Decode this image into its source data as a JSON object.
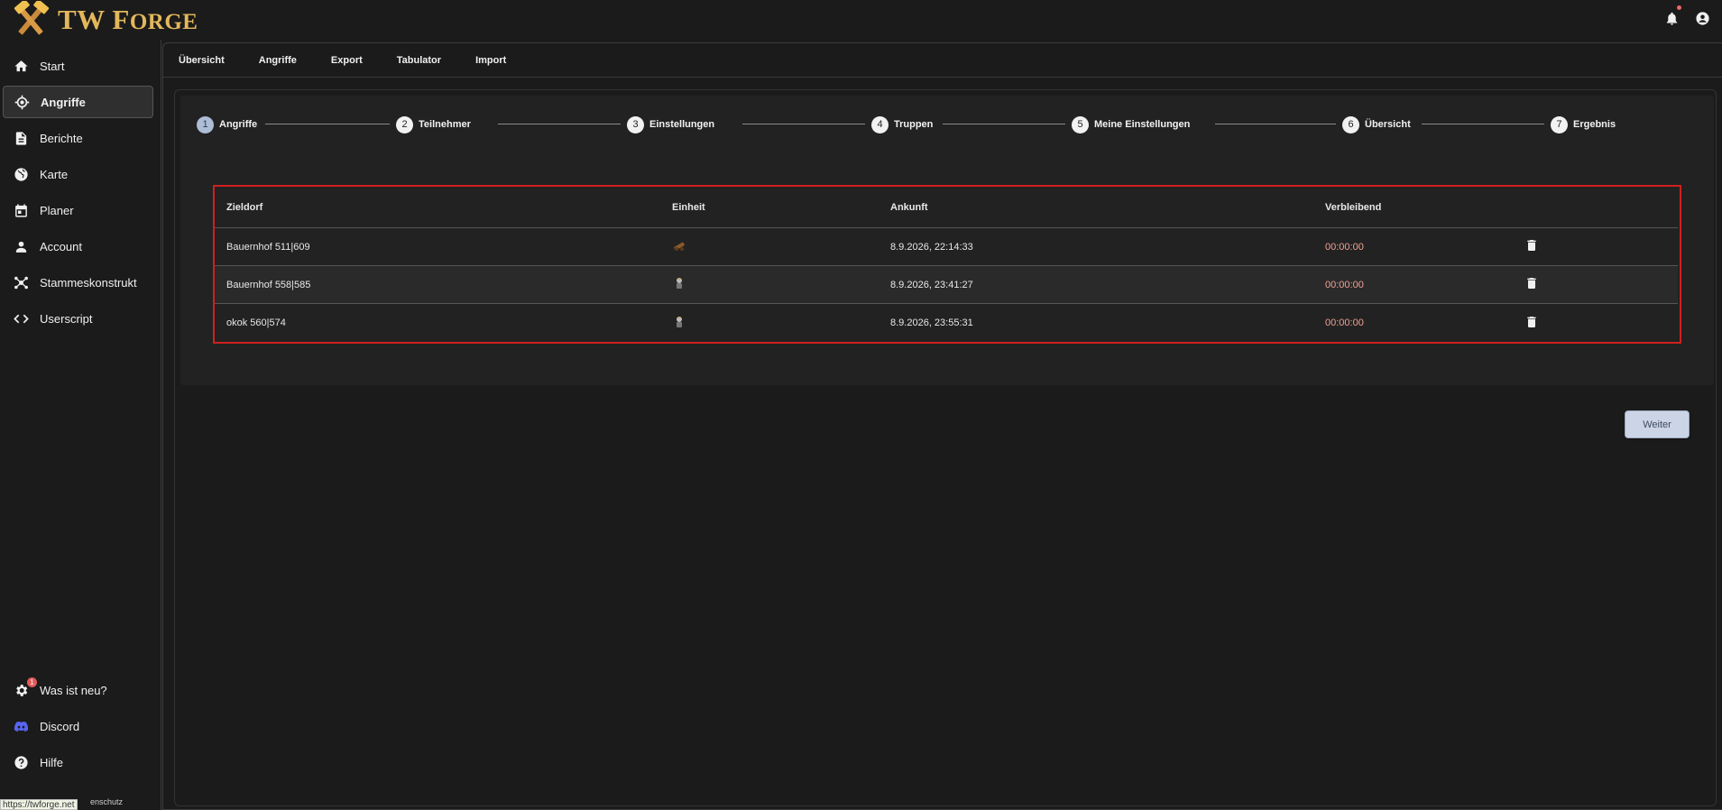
{
  "brand": {
    "name_big": "TW F",
    "name_small": "ORGE"
  },
  "sidebar": {
    "items": [
      {
        "label": "Start",
        "icon": "home-icon"
      },
      {
        "label": "Angriffe",
        "icon": "target-icon"
      },
      {
        "label": "Berichte",
        "icon": "document-icon"
      },
      {
        "label": "Karte",
        "icon": "globe-icon"
      },
      {
        "label": "Planer",
        "icon": "calendar-icon"
      },
      {
        "label": "Account",
        "icon": "user-icon"
      },
      {
        "label": "Stammeskonstrukt",
        "icon": "network-icon"
      },
      {
        "label": "Userscript",
        "icon": "code-icon"
      }
    ],
    "bottom_items": [
      {
        "label": "Was ist neu?",
        "icon": "gear-icon",
        "badge": "1"
      },
      {
        "label": "Discord",
        "icon": "discord-icon"
      },
      {
        "label": "Hilfe",
        "icon": "help-icon"
      }
    ],
    "footer_link": "enschutz",
    "status_url": "https://twforge.net"
  },
  "tabs": [
    "Übersicht",
    "Angriffe",
    "Export",
    "Tabulator",
    "Import"
  ],
  "stepper": [
    {
      "num": "1",
      "label": "Angriffe"
    },
    {
      "num": "2",
      "label": "Teilnehmer"
    },
    {
      "num": "3",
      "label": "Einstellungen"
    },
    {
      "num": "4",
      "label": "Truppen"
    },
    {
      "num": "5",
      "label": "Meine Einstellungen"
    },
    {
      "num": "6",
      "label": "Übersicht"
    },
    {
      "num": "7",
      "label": "Ergebnis"
    }
  ],
  "table": {
    "headers": [
      "Zieldorf",
      "Einheit",
      "Ankunft",
      "Verbleibend"
    ],
    "rows": [
      {
        "village": "Bauernhof 511|609",
        "unit": "ram",
        "arrival": "8.9.2026, 22:14:33",
        "remaining": "00:00:00"
      },
      {
        "village": "Bauernhof 558|585",
        "unit": "noble",
        "arrival": "8.9.2026, 23:41:27",
        "remaining": "00:00:00"
      },
      {
        "village": "okok 560|574",
        "unit": "noble",
        "arrival": "8.9.2026, 23:55:31",
        "remaining": "00:00:00"
      }
    ]
  },
  "buttons": {
    "next": "Weiter"
  },
  "colors": {
    "accent": "#e3b75c",
    "highlight_border": "#d11f1f",
    "remaining_text": "#f0a095"
  }
}
